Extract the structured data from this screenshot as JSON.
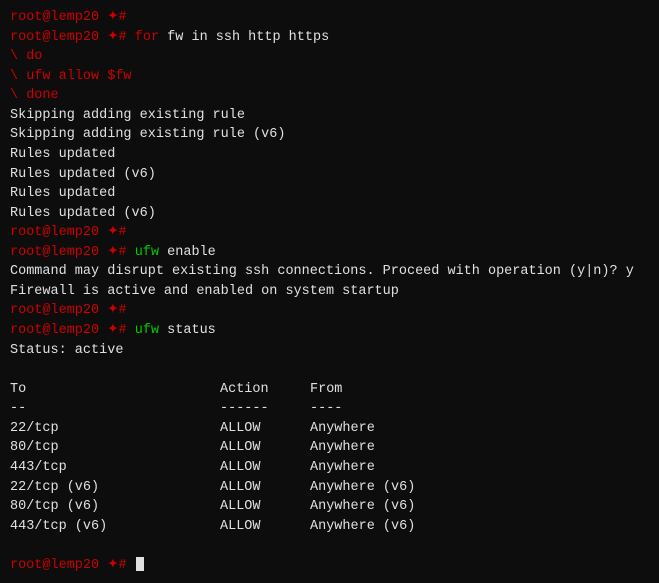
{
  "terminal": {
    "lines": [
      {
        "type": "prompt-only",
        "prompt": "root@lemp20",
        "symbol": " ✦#"
      },
      {
        "type": "command",
        "prompt": "root@lemp20",
        "symbol": " ✦# ",
        "keyword": "for",
        "rest": " fw in ssh http https"
      },
      {
        "type": "output",
        "text": "\\ do"
      },
      {
        "type": "output",
        "text": "\\ ufw allow $fw"
      },
      {
        "type": "output",
        "text": "\\ done"
      },
      {
        "type": "output",
        "text": "Skipping adding existing rule"
      },
      {
        "type": "output",
        "text": "Skipping adding existing rule (v6)"
      },
      {
        "type": "output",
        "text": "Rules updated"
      },
      {
        "type": "output",
        "text": "Rules updated (v6)"
      },
      {
        "type": "output",
        "text": "Rules updated"
      },
      {
        "type": "output",
        "text": "Rules updated (v6)"
      },
      {
        "type": "prompt-only",
        "prompt": "root@lemp20",
        "symbol": " ✦#"
      },
      {
        "type": "command",
        "prompt": "root@lemp20",
        "symbol": " ✦# ",
        "keyword": "ufw",
        "rest": " enable"
      },
      {
        "type": "output",
        "text": "Command may disrupt existing ssh connections. Proceed with operation (y|n)? y"
      },
      {
        "type": "output",
        "text": "Firewall is active and enabled on system startup"
      },
      {
        "type": "prompt-only",
        "prompt": "root@lemp20",
        "symbol": " ✦#"
      },
      {
        "type": "command",
        "prompt": "root@lemp20",
        "symbol": " ✦# ",
        "keyword": "ufw",
        "rest": " status"
      },
      {
        "type": "output",
        "text": "Status: active"
      },
      {
        "type": "blank"
      },
      {
        "type": "table-header",
        "to": "To",
        "action": "Action",
        "from": "From"
      },
      {
        "type": "table-sep",
        "to": "--",
        "action": "------",
        "from": "----"
      },
      {
        "type": "table-row",
        "to": "22/tcp",
        "action": "ALLOW",
        "from": "Anywhere"
      },
      {
        "type": "table-row",
        "to": "80/tcp",
        "action": "ALLOW",
        "from": "Anywhere"
      },
      {
        "type": "table-row",
        "to": "443/tcp",
        "action": "ALLOW",
        "from": "Anywhere"
      },
      {
        "type": "table-row",
        "to": "22/tcp (v6)",
        "action": "ALLOW",
        "from": "Anywhere (v6)"
      },
      {
        "type": "table-row",
        "to": "80/tcp (v6)",
        "action": "ALLOW",
        "from": "Anywhere (v6)"
      },
      {
        "type": "table-row",
        "to": "443/tcp (v6)",
        "action": "ALLOW",
        "from": "Anywhere (v6)"
      },
      {
        "type": "blank"
      },
      {
        "type": "prompt-cursor",
        "prompt": "root@lemp20",
        "symbol": " ✦# "
      }
    ]
  }
}
